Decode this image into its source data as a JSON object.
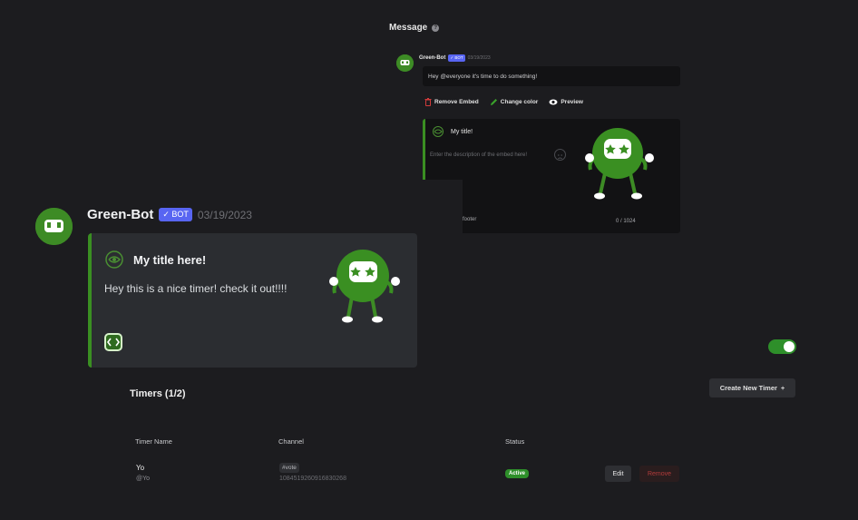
{
  "editor": {
    "section_title": "Message",
    "bot_name": "Green-Bot",
    "bot_tag": "✓ BOT",
    "date": "03/19/2023",
    "message_value": "Hey @everyone it's time to do something!",
    "actions": [
      {
        "label": "Remove Embed",
        "icon": "trash-icon"
      },
      {
        "label": "Change color",
        "icon": "pencil-icon"
      },
      {
        "label": "Preview",
        "icon": "eye-icon"
      }
    ],
    "embed": {
      "title": "My title!",
      "description_placeholder": "Enter the description of the embed here!",
      "footer": "footer",
      "counter": "0 / 1024"
    }
  },
  "preview": {
    "bot_name": "Green-Bot",
    "bot_tag": "✓ BOT",
    "date": "03/19/2023",
    "embed_title": "My title here!",
    "embed_description": "Hey this is a nice timer! check it out!!!!"
  },
  "timers": {
    "title": "Timers (1/2)",
    "create_label": "Create New Timer",
    "columns": [
      "Timer Name",
      "Channel",
      "Status"
    ],
    "rows": [
      {
        "name": "Yo",
        "sub": "@Yo",
        "channel": "#vote",
        "channel_id": "1084519260916830268",
        "status": "Active",
        "edit": "Edit",
        "remove": "Remove"
      }
    ]
  },
  "colors": {
    "accent_green": "#3a8f22",
    "bot_tag": "#5865f2",
    "danger": "#b33b3b"
  }
}
